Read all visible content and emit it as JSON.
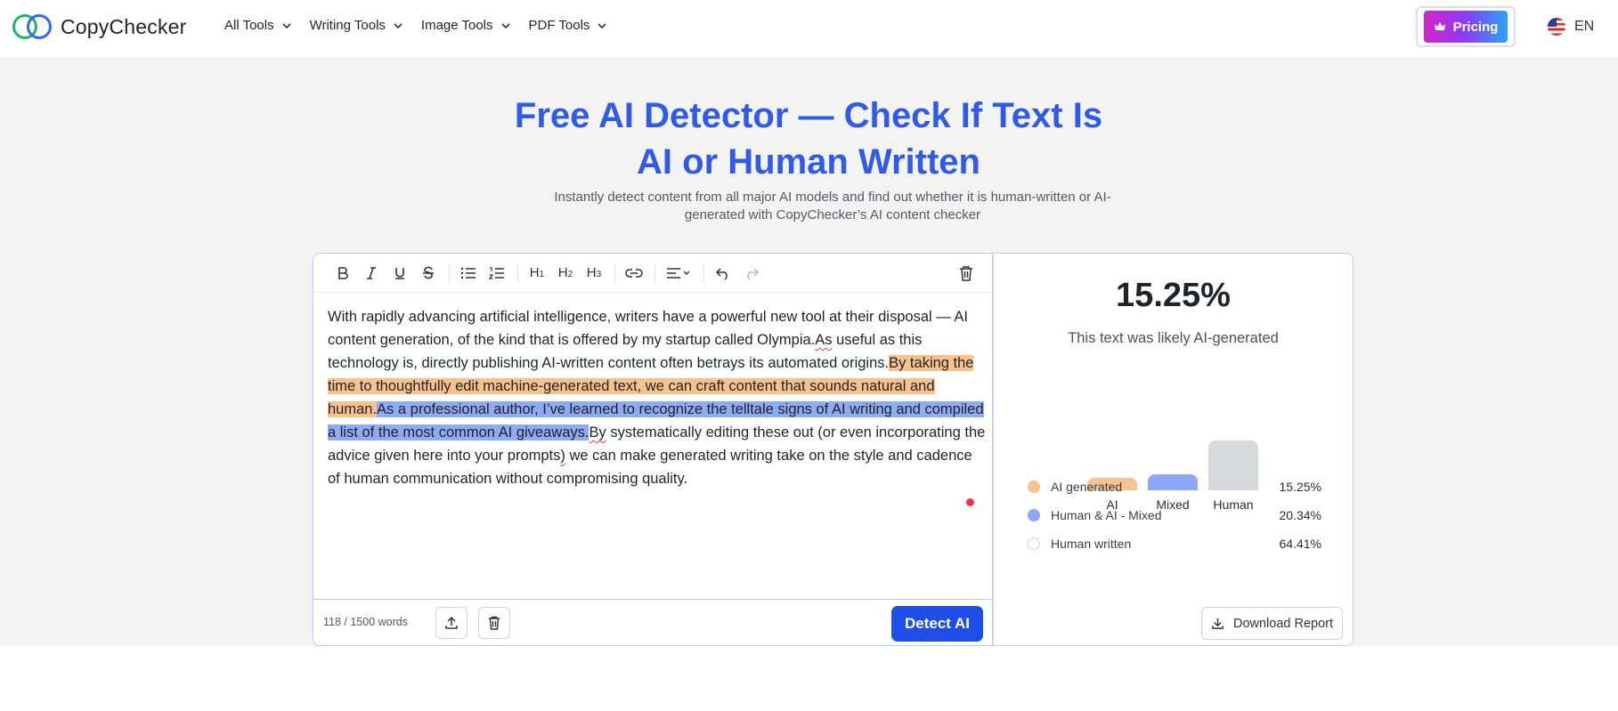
{
  "header": {
    "logo_text": "CopyChecker",
    "nav": [
      {
        "label": "All Tools"
      },
      {
        "label": "Writing Tools"
      },
      {
        "label": "Image Tools"
      },
      {
        "label": "PDF Tools"
      }
    ],
    "pricing_label": "Pricing",
    "language": "EN"
  },
  "hero": {
    "title": "Free AI Detector — Check If Text Is AI or Human Written",
    "subtitle": "Instantly detect content from all major AI models and find out whether it is human-written or AI-generated with CopyChecker’s AI content checker"
  },
  "editor": {
    "segments": [
      {
        "text": "With rapidly advancing artificial intelligence, writers have a powerful new tool at their disposal — AI content generation, of the kind that is offered by my startup called Olympia.",
        "style": "plain"
      },
      {
        "text": "As",
        "style": "squiggle"
      },
      {
        "text": " useful as this technology is, directly publishing AI-written content often betrays its automated origins.",
        "style": "plain"
      },
      {
        "text": "By taking the time to thoughtfully edit machine-generated text, we can craft content that sounds natural and human.",
        "style": "ai"
      },
      {
        "text": "As a professional author, I’ve learned to recognize the telltale signs of AI writing and compiled a list of the most common AI giveaways.",
        "style": "mixed"
      },
      {
        "text": "By",
        "style": "squiggle"
      },
      {
        "text": " systematically editing these out (or even incorporating the advice given here into your prompts",
        "style": "plain"
      },
      {
        "text": ")",
        "style": "squiggle"
      },
      {
        "text": " we can make generated writing take on the style and cadence of human communication without compromising quality.",
        "style": "plain"
      }
    ],
    "word_count": "118 / 1500 words",
    "detect_label": "Detect AI"
  },
  "result": {
    "score": "15.25%",
    "verdict": "This text was likely AI-generated",
    "download_label": "Download Report"
  },
  "chart_data": {
    "type": "bar",
    "categories": [
      "AI",
      "Mixed",
      "Human"
    ],
    "values": [
      15.25,
      20.34,
      64.41
    ],
    "colors": [
      "#f8c38f",
      "#8fa8f6",
      "#d6d8dc"
    ],
    "ylim": [
      0,
      64.41
    ]
  },
  "legend": [
    {
      "label": "AI generated",
      "value": "15.25%",
      "color": "#f8c38f",
      "hollow": false
    },
    {
      "label": "Human & AI - Mixed",
      "value": "20.34%",
      "color": "#8fa8f6",
      "hollow": false
    },
    {
      "label": "Human written",
      "value": "64.41%",
      "color": "#ffffff",
      "hollow": true
    }
  ],
  "icons": {
    "bold": "bold-icon",
    "italic": "italic-icon",
    "underline": "underline-icon",
    "strike": "strikethrough-icon",
    "bullets": "bullet-list-icon",
    "numbers": "numbered-list-icon",
    "link": "link-icon",
    "align": "align-icon",
    "undo": "undo-icon",
    "redo": "redo-icon",
    "trash": "trash-icon",
    "upload": "upload-icon",
    "download": "download-icon",
    "crown": "crown-icon",
    "flag": "us-flag-icon"
  },
  "colors": {
    "accent": "#2f5be8",
    "detect_button": "#1d4fe8",
    "ai_highlight": "#f9c28c",
    "mixed_highlight": "#8fabf4"
  }
}
